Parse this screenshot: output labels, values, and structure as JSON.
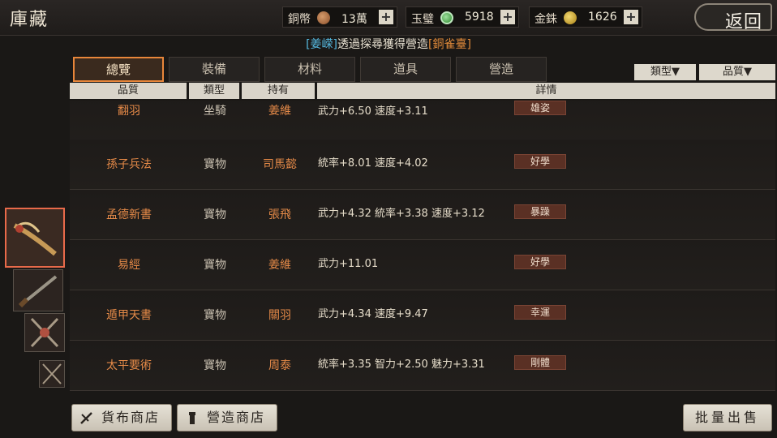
{
  "title": "庫藏",
  "resources": [
    {
      "label": "銅幣",
      "value": "13萬",
      "color": "#b87a4a"
    },
    {
      "label": "玉璧",
      "value": "5918",
      "color": "#4fb24f"
    },
    {
      "label": "金銖",
      "value": "1626",
      "color": "#d9b030"
    }
  ],
  "back_label": "返回",
  "notice": {
    "person": "[姜嵘]",
    "middle": "透過探尋獲得營造",
    "item": "[銅雀臺]"
  },
  "tabs": [
    "總覽",
    "裝備",
    "材料",
    "道具",
    "營造"
  ],
  "filters": [
    "類型▼",
    "品質▼"
  ],
  "columns": [
    "品質",
    "類型",
    "持有",
    "詳情"
  ],
  "rows": [
    {
      "name": "翻羽",
      "type": "坐騎",
      "owner": "姜維",
      "stats": "武力+6.50  速度+3.11",
      "tag": "雄姿"
    },
    {
      "name": "孫子兵法",
      "type": "寶物",
      "owner": "司馬懿",
      "stats": "統率+8.01  速度+4.02",
      "tag": "好學"
    },
    {
      "name": "孟德新書",
      "type": "寶物",
      "owner": "張飛",
      "stats": "武力+4.32  統率+3.38  速度+3.12",
      "tag": "暴躁"
    },
    {
      "name": "易經",
      "type": "寶物",
      "owner": "姜維",
      "stats": "武力+11.01",
      "tag": "好學"
    },
    {
      "name": "遁甲天書",
      "type": "寶物",
      "owner": "關羽",
      "stats": "武力+4.34  速度+9.47",
      "tag": "幸運"
    },
    {
      "name": "太平要術",
      "type": "寶物",
      "owner": "周泰",
      "stats": "統率+3.35  智力+2.50  魅力+3.31",
      "tag": "剛體"
    }
  ],
  "buttons": {
    "currency_shop": "貨布商店",
    "build_shop": "營造商店",
    "bulk_sell": "批量出售"
  },
  "icons": [
    "weapon-thumb-icon",
    "sword-thumb-icon",
    "crossed-axes-icon",
    "crossed-blades-icon"
  ]
}
